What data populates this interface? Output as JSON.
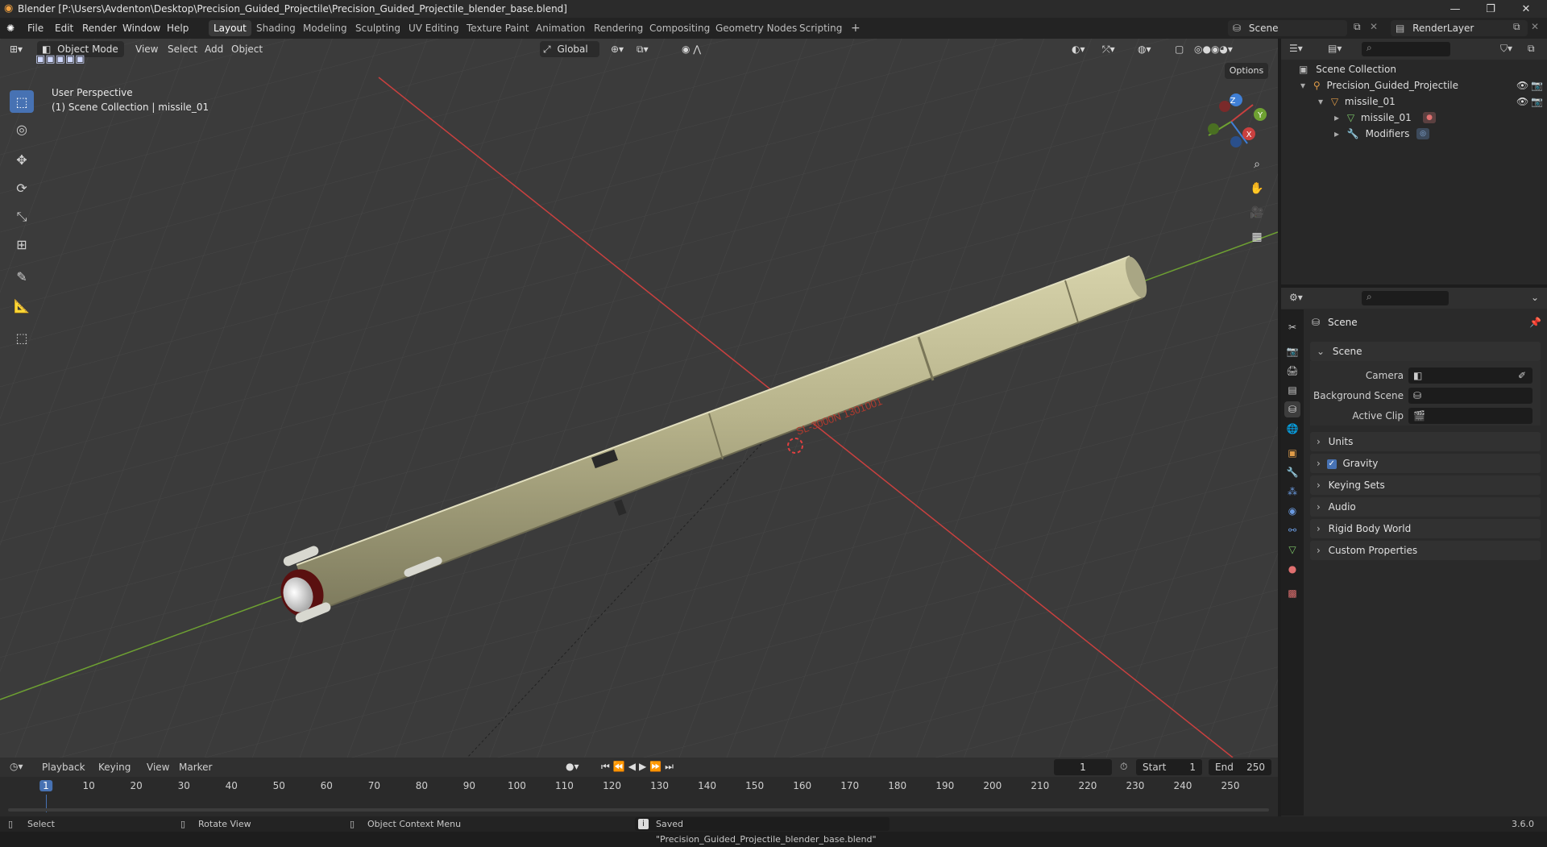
{
  "window": {
    "title": "Blender [P:\\Users\\Avdenton\\Desktop\\Precision_Guided_Projectile\\Precision_Guided_Projectile_blender_base.blend]"
  },
  "menus": [
    "File",
    "Edit",
    "Render",
    "Window",
    "Help"
  ],
  "workspaces": [
    "Layout",
    "Shading",
    "Modeling",
    "Sculpting",
    "UV Editing",
    "Texture Paint",
    "Animation",
    "Rendering",
    "Compositing",
    "Geometry Nodes",
    "Scripting"
  ],
  "active_workspace": "Layout",
  "scene_name": "Scene",
  "render_layer": "RenderLayer",
  "viewport": {
    "mode": "Object Mode",
    "menus": [
      "View",
      "Select",
      "Add",
      "Object"
    ],
    "transform_orientation": "Global",
    "options_label": "Options",
    "perspective_label": "User Perspective",
    "collection_label": "(1) Scene Collection | missile_01",
    "decal_text": "SL-3000N  1301001",
    "gizmo_axes": {
      "x": "X",
      "y": "Y",
      "z": "Z"
    }
  },
  "outliner": {
    "root": "Scene Collection",
    "items": [
      {
        "label": "Precision_Guided_Projectile"
      },
      {
        "label": "missile_01"
      },
      {
        "label": "missile_01"
      },
      {
        "label": "Modifiers"
      }
    ]
  },
  "properties": {
    "header": "Scene",
    "section": "Scene",
    "fields": [
      {
        "label": "Camera"
      },
      {
        "label": "Background Scene"
      },
      {
        "label": "Active Clip"
      }
    ],
    "panels": [
      "Units",
      "Gravity",
      "Keying Sets",
      "Audio",
      "Rigid Body World",
      "Custom Properties"
    ],
    "gravity_checked": true
  },
  "timeline": {
    "menus": [
      "Playback",
      "Keying",
      "View",
      "Marker"
    ],
    "current_frame": "1",
    "start_label": "Start",
    "start": "1",
    "end_label": "End",
    "end": "250",
    "ticks": [
      "1",
      "10",
      "20",
      "30",
      "40",
      "50",
      "60",
      "70",
      "80",
      "90",
      "100",
      "110",
      "120",
      "130",
      "140",
      "150",
      "160",
      "170",
      "180",
      "190",
      "200",
      "210",
      "220",
      "230",
      "240",
      "250"
    ]
  },
  "statusbar": {
    "select": "Select",
    "rotate": "Rotate View",
    "context": "Object Context Menu",
    "message": "Saved \"Precision_Guided_Projectile_blender_base.blend\"",
    "version": "3.6.0"
  },
  "colors": {
    "accent": "#4772b3",
    "x_axis": "#c9403f",
    "y_axis": "#6ea132",
    "z_axis": "#3f7fd6",
    "missile_body": "#b8b48c"
  }
}
